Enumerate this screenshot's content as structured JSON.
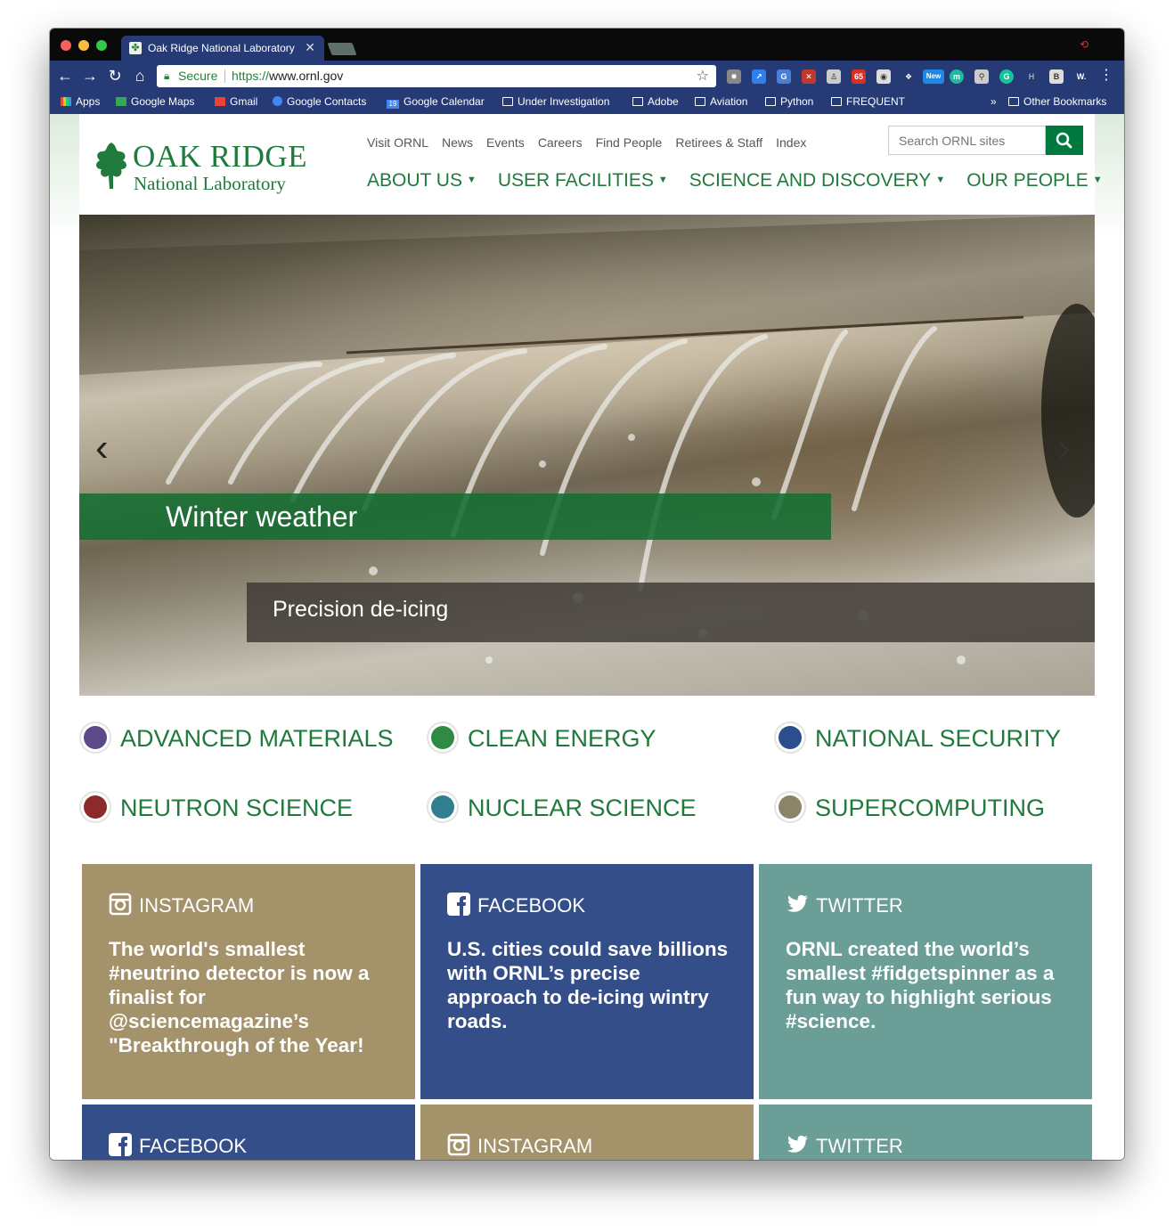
{
  "browser": {
    "tab_title": "Oak Ridge National Laboratory",
    "security_label": "Secure",
    "url_scheme": "https://",
    "url_host": "www.ornl.gov",
    "extension_badge_gmail": "65",
    "extension_badge_new": "New",
    "bookmarks": [
      "Apps",
      "Google Maps",
      "Gmail",
      "Google Contacts",
      "Google Calendar",
      "Under Investigation",
      "Adobe",
      "Aviation",
      "Python",
      "FREQUENT"
    ],
    "bookmarks_overflow": "»",
    "other_bookmarks": "Other Bookmarks",
    "calendar_badge": "19"
  },
  "site": {
    "logo_name": "OAK RIDGE",
    "logo_sub": "National Laboratory",
    "top_links": [
      "Visit ORNL",
      "News",
      "Events",
      "Careers",
      "Find People",
      "Retirees & Staff",
      "Index"
    ],
    "search_placeholder": "Search ORNL sites",
    "main_nav": [
      "ABOUT US",
      "USER FACILITIES",
      "SCIENCE AND DISCOVERY",
      "OUR PEOPLE"
    ]
  },
  "hero": {
    "title": "Winter weather",
    "caption": "Precision de-icing"
  },
  "topics": [
    "ADVANCED MATERIALS",
    "CLEAN ENERGY",
    "NATIONAL SECURITY",
    "NEUTRON SCIENCE",
    "NUCLEAR SCIENCE",
    "SUPERCOMPUTING"
  ],
  "topic_colors": [
    "#5b4a87",
    "#2f8a44",
    "#2d4e8c",
    "#8c2a2a",
    "#2f7f8f",
    "#8a8468"
  ],
  "social": [
    {
      "network": "INSTAGRAM",
      "text": "The world's smallest #neutrino detector is now a finalist for @sciencemagazine’s \"Breakthrough of the Year!"
    },
    {
      "network": "FACEBOOK",
      "text": "U.S. cities could save billions with ORNL’s precise approach to de-icing wintry roads."
    },
    {
      "network": "TWITTER",
      "text": "ORNL created the world’s smallest #fidgetspinner as a fun way to highlight serious #science."
    },
    {
      "network": "FACEBOOK",
      "text": ""
    },
    {
      "network": "INSTAGRAM",
      "text": ""
    },
    {
      "network": "TWITTER",
      "text": ""
    }
  ],
  "colors": {
    "brand_green": "#1f7a3c",
    "search_green": "#00793f",
    "tile_tan": "#a4926a",
    "tile_blue": "#344e8a",
    "tile_teal": "#6a9e96"
  }
}
